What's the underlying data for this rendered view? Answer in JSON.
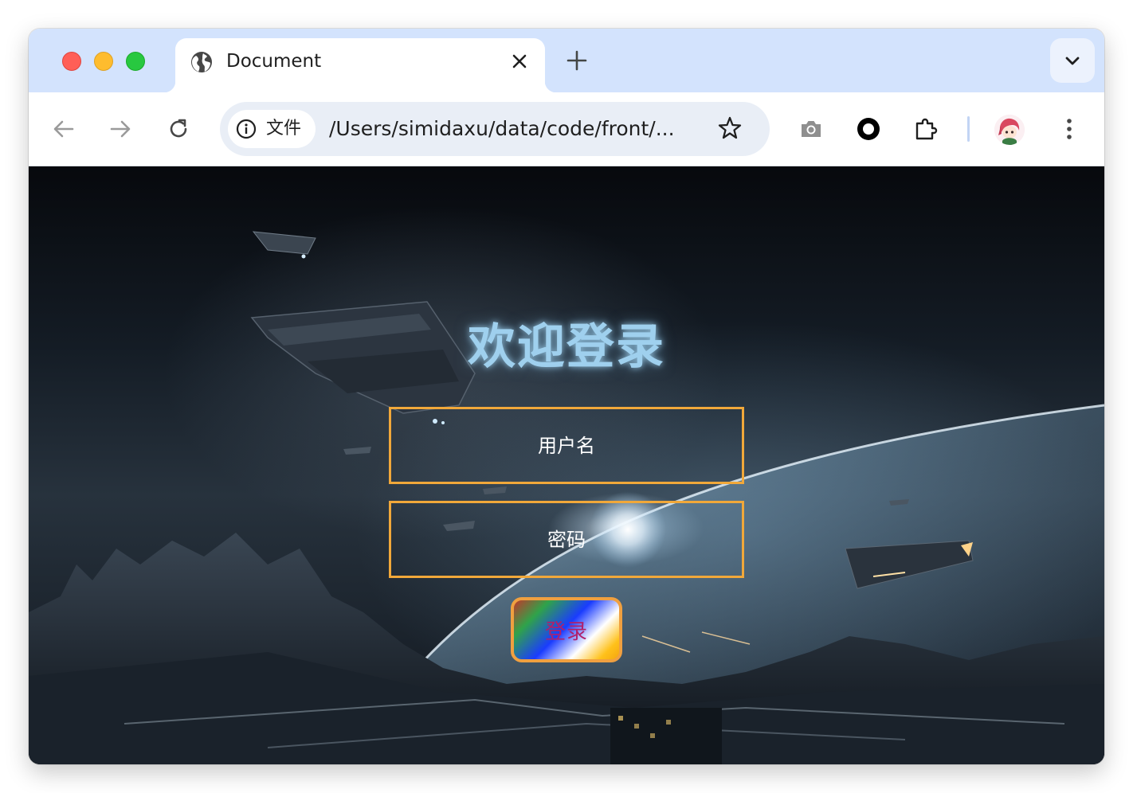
{
  "browser": {
    "tab": {
      "title": "Document"
    },
    "omnibox": {
      "chip_label": "文件",
      "url": "/Users/simidaxu/data/code/front/..."
    }
  },
  "page": {
    "heading": "欢迎登录",
    "username_placeholder": "用户名",
    "password_placeholder": "密码",
    "login_button": "登录"
  },
  "colors": {
    "tabstrip": "#d3e3fd",
    "field_border": "#f1a83a",
    "heading": "#9fd0ee",
    "button_text": "#b0206b"
  }
}
